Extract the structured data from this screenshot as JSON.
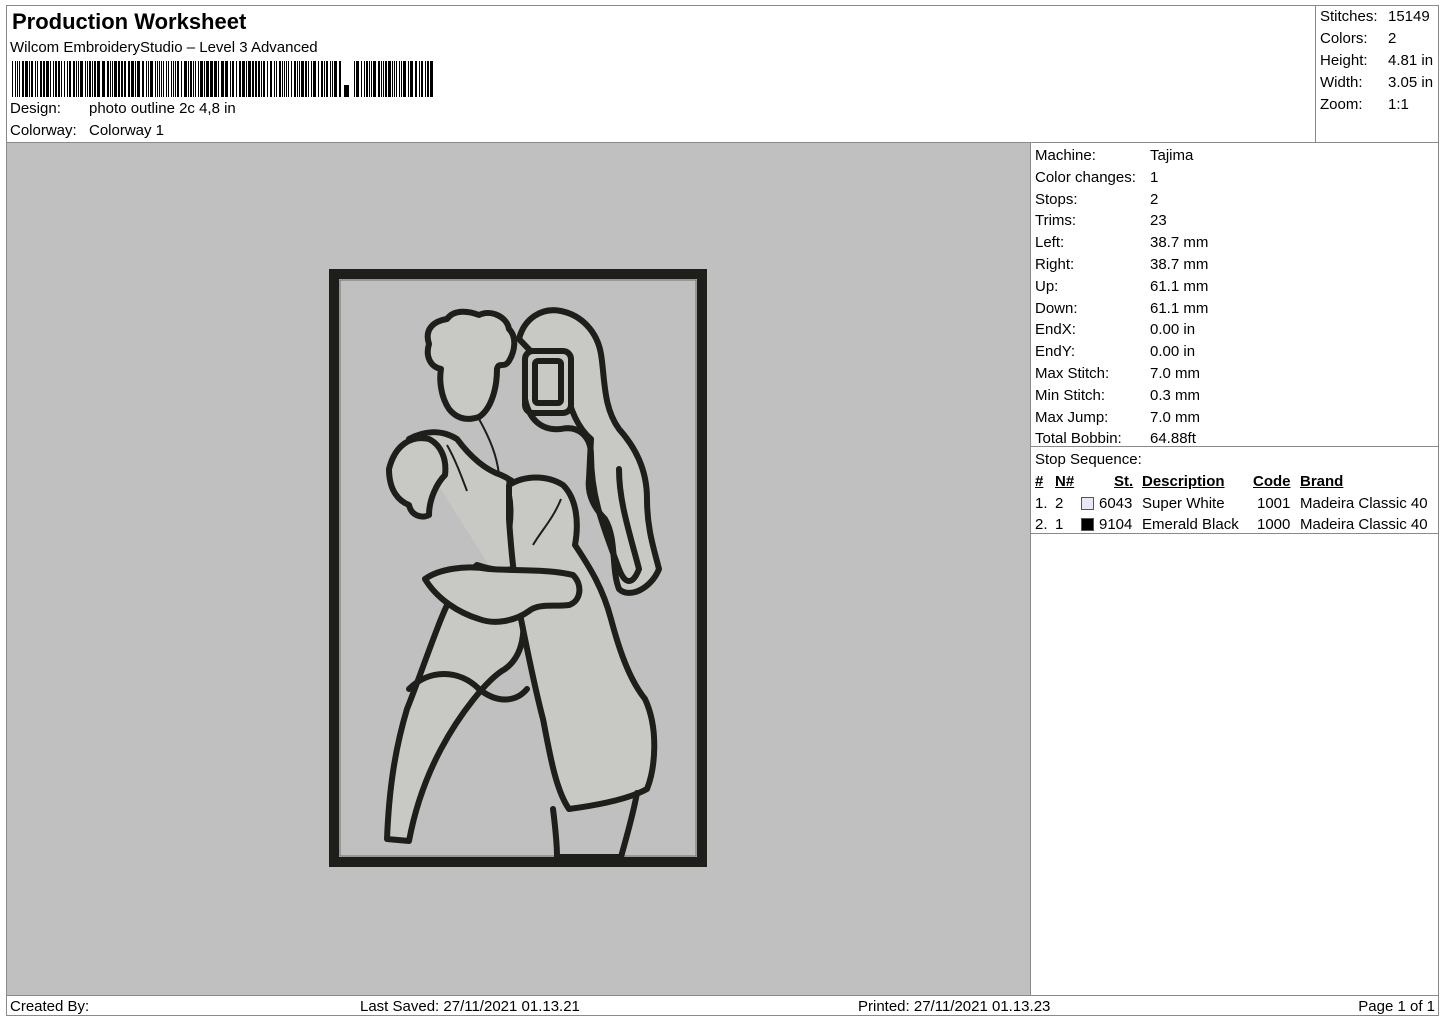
{
  "header": {
    "title": "Production Worksheet",
    "subtitle": "Wilcom EmbroideryStudio – Level 3 Advanced",
    "design_label": "Design:",
    "design_value": "photo outline 2c 4,8 in",
    "colorway_label": "Colorway:",
    "colorway_value": "Colorway 1"
  },
  "summary": [
    {
      "label": "Stitches:",
      "value": "15149"
    },
    {
      "label": "Colors:",
      "value": "2"
    },
    {
      "label": "Height:",
      "value": "4.81 in"
    },
    {
      "label": "Width:",
      "value": "3.05 in"
    },
    {
      "label": "Zoom:",
      "value": "1:1"
    }
  ],
  "machine_info": [
    {
      "label": "Machine:",
      "value": "Tajima"
    },
    {
      "label": "Color changes:",
      "value": "1"
    },
    {
      "label": "Stops:",
      "value": "2"
    },
    {
      "label": "Trims:",
      "value": "23"
    },
    {
      "label": "Left:",
      "value": "38.7 mm"
    },
    {
      "label": "Right:",
      "value": "38.7 mm"
    },
    {
      "label": "Up:",
      "value": "61.1 mm"
    },
    {
      "label": "Down:",
      "value": "61.1 mm"
    },
    {
      "label": "EndX:",
      "value": "0.00 in"
    },
    {
      "label": "EndY:",
      "value": "0.00 in"
    },
    {
      "label": "Max Stitch:",
      "value": "7.0 mm"
    },
    {
      "label": "Min Stitch:",
      "value": "0.3 mm"
    },
    {
      "label": "Max Jump:",
      "value": "7.0 mm"
    },
    {
      "label": "Total Bobbin:",
      "value": "64.88ft"
    }
  ],
  "stop_sequence": {
    "caption": "Stop Sequence:",
    "headers": [
      "#",
      "N#",
      "St.",
      "Description",
      "Code",
      "Brand"
    ],
    "rows": [
      {
        "num": "1.",
        "n": "2",
        "swatch_color": "#e8e8f4",
        "st": "6043",
        "description": "Super White",
        "code": "1001",
        "brand": "Madeira Classic 40"
      },
      {
        "num": "2.",
        "n": "1",
        "swatch_color": "#000000",
        "st": "9104",
        "description": "Emerald Black",
        "code": "1000",
        "brand": "Madeira Classic 40"
      }
    ]
  },
  "preview": {
    "background_color": "#c0c0c0",
    "thread_dark": "#1e1e1a",
    "thread_light": "#d8d8d4"
  },
  "footer": {
    "created_by": "Created By:",
    "last_saved": "Last Saved: 27/11/2021 01.13.21",
    "printed": "Printed: 27/11/2021 01.13.23",
    "page": "Page 1 of 1"
  }
}
